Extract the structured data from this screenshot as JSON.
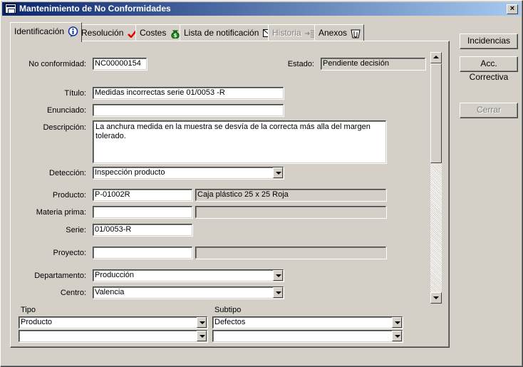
{
  "window": {
    "title": "Mantenimiento de No Conformidades",
    "close_label": "×"
  },
  "tabs": [
    {
      "label": "Identificación",
      "icon": "info-icon"
    },
    {
      "label": "Resolución",
      "icon": "checkmark-icon"
    },
    {
      "label": "Costes",
      "icon": "money-bag-icon"
    },
    {
      "label": "Lista de notificación",
      "icon": "envelope-icon"
    },
    {
      "label": "Historia",
      "icon": "list-arrow-icon"
    },
    {
      "label": "Anexos",
      "icon": "paperclip-icon"
    }
  ],
  "form": {
    "no_conformidad": {
      "label": "No conformidad:",
      "value": "NC00000154"
    },
    "estado": {
      "label": "Estado:",
      "value": "Pendiente decisión"
    },
    "titulo": {
      "label": "Título:",
      "value": "Medidas incorrectas serie 01/0053 -R"
    },
    "enunciado": {
      "label": "Enunciado:",
      "value": ""
    },
    "descripcion": {
      "label": "Descripción:",
      "value": "La anchura medida en la muestra se desvía de la correcta más alla del margen tolerado."
    },
    "deteccion": {
      "label": "Detección:",
      "value": "Inspección producto"
    },
    "producto": {
      "label": "Producto:",
      "value": "P-01002R",
      "description": "Caja plástico 25 x 25 Roja"
    },
    "materia_prima": {
      "label": "Materia prima:",
      "value": "",
      "description": ""
    },
    "serie": {
      "label": "Serie:",
      "value": "01/0053-R"
    },
    "proyecto": {
      "label": "Proyecto:",
      "value": "",
      "description": ""
    },
    "departamento": {
      "label": "Departamento:",
      "value": "Producción"
    },
    "centro": {
      "label": "Centro:",
      "value": "Valencia"
    },
    "tipo": {
      "label": "Tipo",
      "value1": "Producto",
      "value2": ""
    },
    "subtipo": {
      "label": "Subtipo",
      "value1": "Defectos",
      "value2": ""
    }
  },
  "buttons": {
    "incidencias": "Incidencias",
    "acc_correctiva": "Acc. Correctiva",
    "cerrar": "Cerrar"
  },
  "colors": {
    "title_start": "#0a246a",
    "title_end": "#a6caf0",
    "face": "#d4d0c8",
    "check_red": "#e00000",
    "money_green": "#1a8a1a"
  }
}
